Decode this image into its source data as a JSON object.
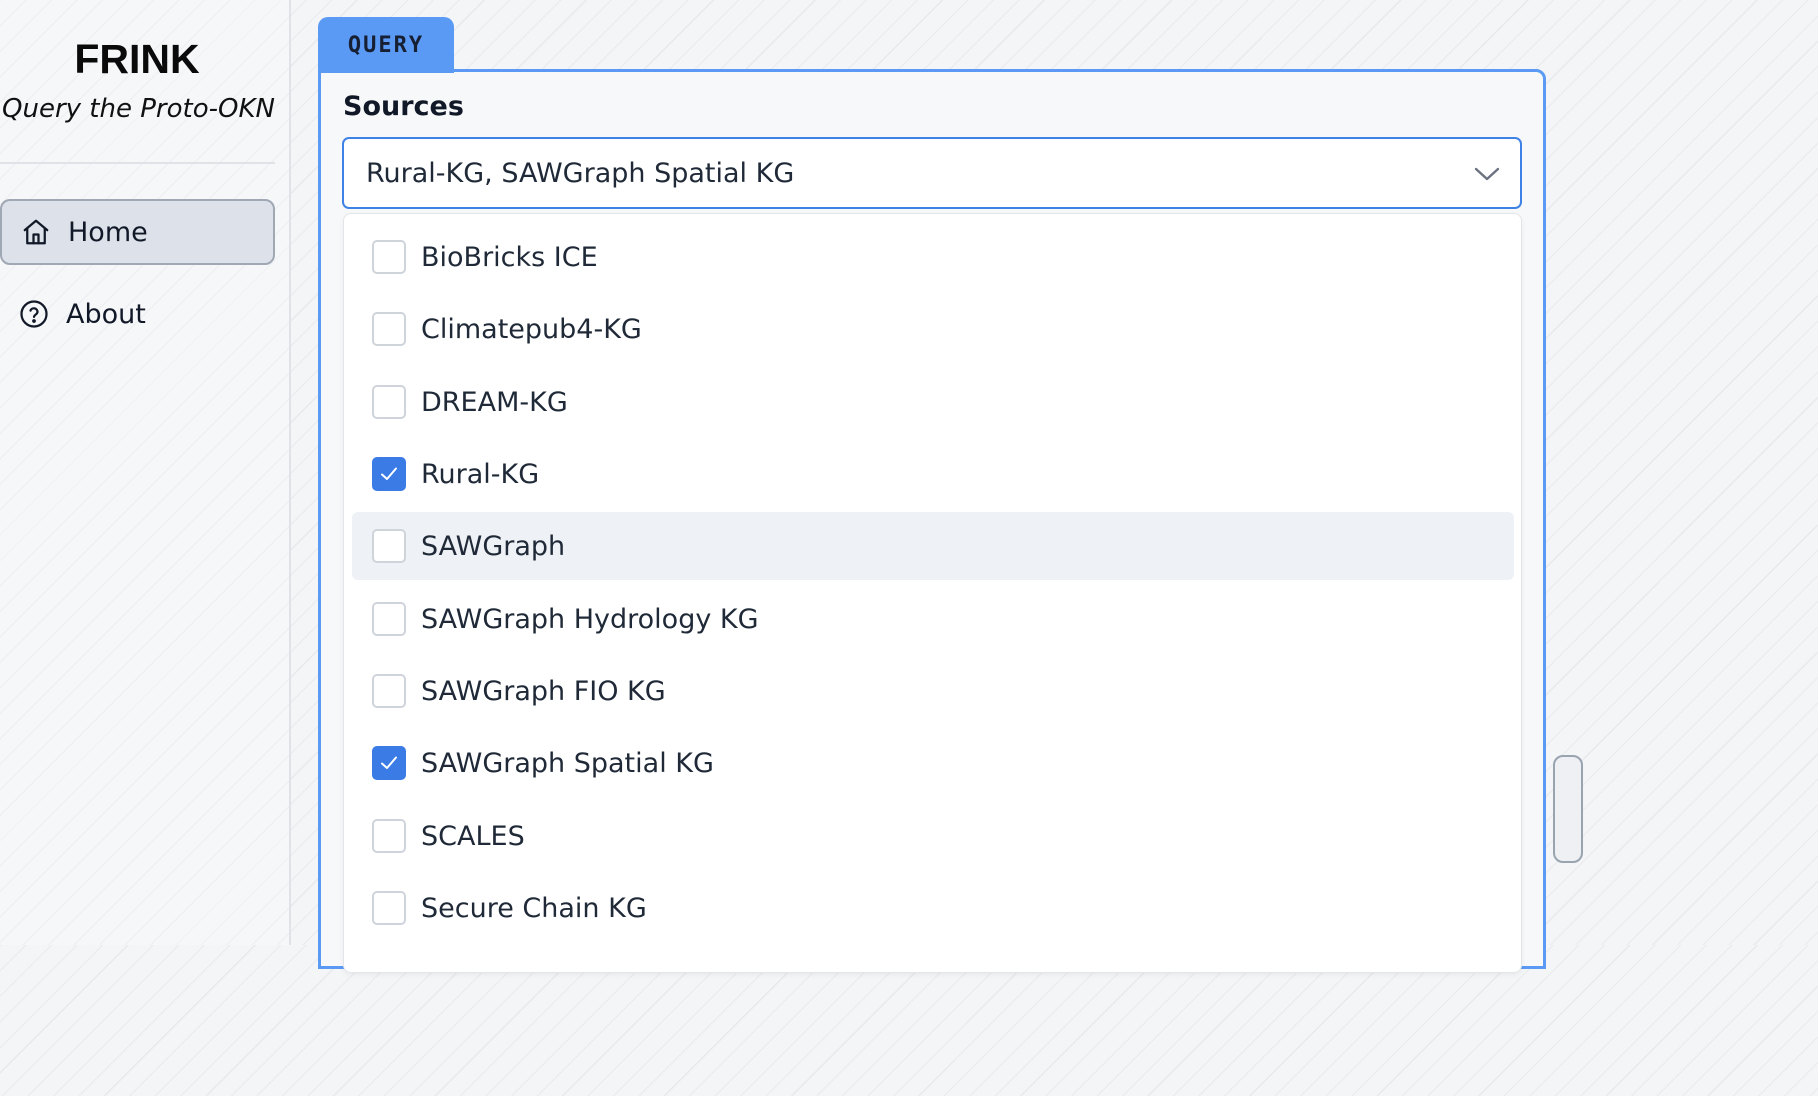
{
  "brand": {
    "title": "FRINK",
    "subtitle": "Query the Proto-OKN"
  },
  "nav": [
    {
      "label": "Home",
      "icon": "home-icon",
      "active": true
    },
    {
      "label": "About",
      "icon": "help-circle-icon",
      "active": false
    }
  ],
  "tab": {
    "label": "QUERY"
  },
  "sources": {
    "label": "Sources",
    "selected_text": "Rural-KG, SAWGraph Spatial KG",
    "options": [
      {
        "label": "BioBricks ICE",
        "checked": false
      },
      {
        "label": "Climatepub4-KG",
        "checked": false
      },
      {
        "label": "DREAM-KG",
        "checked": false
      },
      {
        "label": "Rural-KG",
        "checked": true
      },
      {
        "label": "SAWGraph",
        "checked": false,
        "hovered": true
      },
      {
        "label": "SAWGraph Hydrology KG",
        "checked": false
      },
      {
        "label": "SAWGraph FIO KG",
        "checked": false
      },
      {
        "label": "SAWGraph Spatial KG",
        "checked": true
      },
      {
        "label": "SCALES",
        "checked": false
      },
      {
        "label": "Secure Chain KG",
        "checked": false
      }
    ]
  },
  "colors": {
    "accent": "#5a99f4",
    "checkbox_checked": "#3b7be6",
    "select_border": "#3f82e6"
  }
}
